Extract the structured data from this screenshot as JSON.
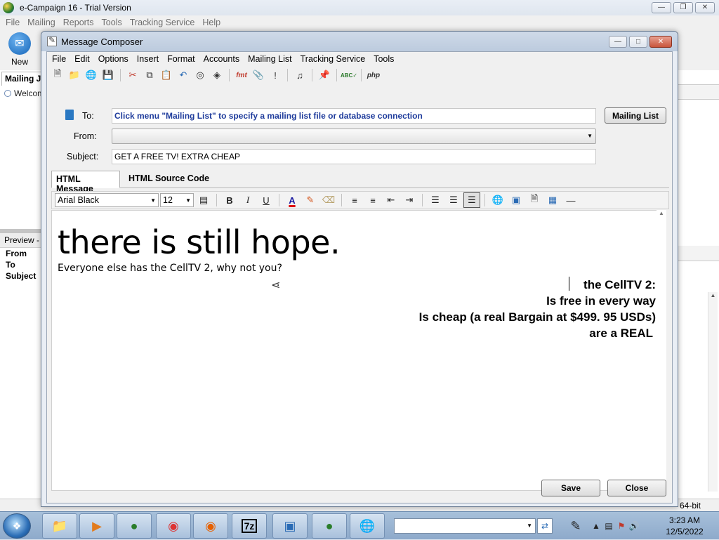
{
  "bg_app": {
    "title": "e-Campaign 16 - Trial Version",
    "menu": [
      "File",
      "Mailing",
      "Reports",
      "Tools",
      "Tracking Service",
      "Help"
    ],
    "new_label": "New",
    "mailing_tab": "Mailing Jo",
    "welcome": "Welcom",
    "preview_title": "Preview -",
    "preview_rows": [
      "From",
      "To",
      "Subject"
    ],
    "status_bits": "64-bit"
  },
  "composer": {
    "title": "Message Composer",
    "menu": [
      "File",
      "Edit",
      "Options",
      "Insert",
      "Format",
      "Accounts",
      "Mailing List",
      "Tracking Service",
      "Tools"
    ],
    "to_label": "To:",
    "to_value": "Click menu \"Mailing List\" to specify a mailing list file or database connection",
    "mailing_list_button": "Mailing List",
    "from_label": "From:",
    "from_value": "",
    "subject_label": "Subject:",
    "subject_value": "GET A FREE TV! EXTRA CHEAP",
    "tabs": [
      "HTML Message",
      "HTML Source Code"
    ],
    "active_tab": "HTML Message",
    "font_name": "Arial Black",
    "font_size": "12",
    "content": {
      "headline": "there is still hope.",
      "subline": "Everyone else has the CellTV 2, why not you?",
      "right_lines": [
        "the CellTV 2:",
        "Is free in every way",
        "Is cheap (a real Bargain at $499. 95 USDs)",
        "are a REAL"
      ]
    },
    "save_button": "Save",
    "close_button": "Close"
  },
  "taskbar": {
    "time": "3:23 AM",
    "date": "12/5/2022",
    "search_value": ""
  },
  "colors": {
    "to_text": "#1f3c9c",
    "close_red": "#c9543b",
    "taskbar": "#a7c0da"
  }
}
